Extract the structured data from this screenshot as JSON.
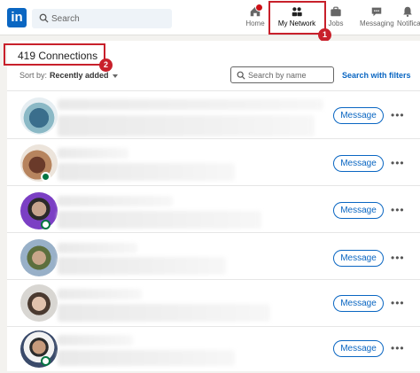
{
  "header": {
    "logo_text": "in",
    "search_placeholder": "Search",
    "nav": [
      {
        "label": "Home",
        "icon": "home-icon"
      },
      {
        "label": "My Network",
        "icon": "network-icon"
      },
      {
        "label": "Jobs",
        "icon": "briefcase-icon"
      },
      {
        "label": "Messaging",
        "icon": "messaging-icon"
      },
      {
        "label": "Notifica",
        "icon": "bell-icon"
      }
    ]
  },
  "annotations": {
    "callout_1": "1",
    "callout_2": "2",
    "highlight_color": "#c8202b"
  },
  "connections": {
    "count_label": "419 Connections",
    "sort_label": "Sort by:",
    "sort_value": "Recently added",
    "search_placeholder": "Search by name",
    "filters_link": "Search with filters",
    "message_label": "Message",
    "more_label": "•••"
  },
  "colors": {
    "brand": "#0a66c2",
    "online": "#057642",
    "badge": "#cc1016"
  }
}
